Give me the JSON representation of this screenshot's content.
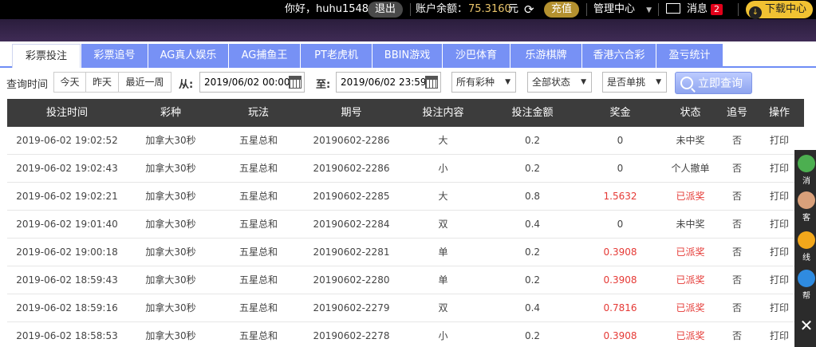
{
  "topbar": {
    "greeting": "你好，huhu1548",
    "logout": "退出",
    "balance_label": "账户余额：",
    "balance_value": "75.3160",
    "currency": "元",
    "recharge": "充值",
    "manage": "管理中心",
    "messages": "消息",
    "message_count": "2",
    "download": "下载中心"
  },
  "tabs": [
    "彩票投注",
    "彩票追号",
    "AG真人娱乐",
    "AG捕鱼王",
    "PT老虎机",
    "BBIN游戏",
    "沙巴体育",
    "乐游棋牌",
    "香港六合彩",
    "盈亏统计"
  ],
  "filters": {
    "query_time_label": "查询时间",
    "today": "今天",
    "yesterday": "昨天",
    "last_week": "最近一周",
    "from_label": "从:",
    "from_value": "2019/06/02 00:00",
    "to_label": "至:",
    "to_value": "2019/06/02 23:59",
    "lottery_select": "所有彩种",
    "status_select": "全部状态",
    "single_select": "是否单挑",
    "query_button": "立即查询"
  },
  "table": {
    "headers": [
      "投注时间",
      "彩种",
      "玩法",
      "期号",
      "投注内容",
      "投注金额",
      "奖金",
      "状态",
      "追号",
      "操作"
    ],
    "rows": [
      [
        "2019-06-02 19:02:52",
        "加拿大30秒",
        "五星总和",
        "20190602-2286",
        "大",
        "0.2",
        "0",
        "未中奖",
        "否",
        "打印"
      ],
      [
        "2019-06-02 19:02:43",
        "加拿大30秒",
        "五星总和",
        "20190602-2286",
        "小",
        "0.2",
        "0",
        "个人撤单",
        "否",
        "打印"
      ],
      [
        "2019-06-02 19:02:21",
        "加拿大30秒",
        "五星总和",
        "20190602-2285",
        "大",
        "0.8",
        "1.5632",
        "已派奖",
        "否",
        "打印"
      ],
      [
        "2019-06-02 19:01:40",
        "加拿大30秒",
        "五星总和",
        "20190602-2284",
        "双",
        "0.4",
        "0",
        "未中奖",
        "否",
        "打印"
      ],
      [
        "2019-06-02 19:00:18",
        "加拿大30秒",
        "五星总和",
        "20190602-2281",
        "单",
        "0.2",
        "0.3908",
        "已派奖",
        "否",
        "打印"
      ],
      [
        "2019-06-02 18:59:43",
        "加拿大30秒",
        "五星总和",
        "20190602-2280",
        "单",
        "0.2",
        "0.3908",
        "已派奖",
        "否",
        "打印"
      ],
      [
        "2019-06-02 18:59:16",
        "加拿大30秒",
        "五星总和",
        "20190602-2279",
        "双",
        "0.4",
        "0.7816",
        "已派奖",
        "否",
        "打印"
      ],
      [
        "2019-06-02 18:58:53",
        "加拿大30秒",
        "五星总和",
        "20190602-2278",
        "小",
        "0.2",
        "0.3908",
        "已派奖",
        "否",
        "打印"
      ]
    ]
  },
  "sidewidgets": [
    "消",
    "客",
    "线",
    "帮"
  ],
  "colors": {
    "tab_bg": "#7791f5",
    "header_bg": "#3c3c3c",
    "win_red": "#e53935",
    "balance_gold": "#e9c46a"
  }
}
